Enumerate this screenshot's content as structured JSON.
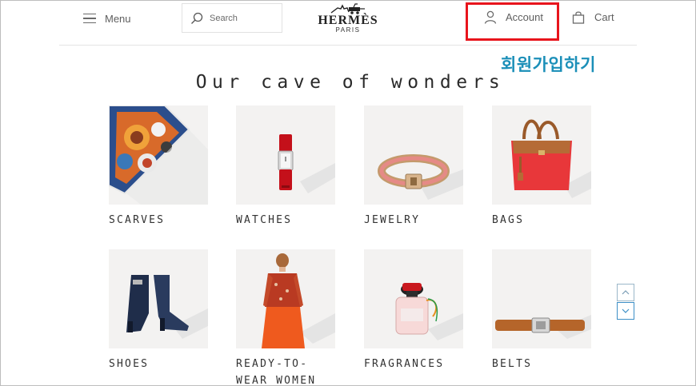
{
  "header": {
    "menu_label": "Menu",
    "search_placeholder": "Search",
    "logo_brand": "HERMÈS",
    "logo_city": "PARIS",
    "account_label": "Account",
    "cart_label": "Cart"
  },
  "annotation": {
    "signup_text": "회원가입하기",
    "highlight_color": "#e8141c",
    "text_color": "#1b8fb8"
  },
  "main": {
    "heading": "Our cave of wonders",
    "categories": [
      {
        "label": "SCARVES",
        "icon": "scarf-image"
      },
      {
        "label": "WATCHES",
        "icon": "watch-image"
      },
      {
        "label": "JEWELRY",
        "icon": "bracelet-image"
      },
      {
        "label": "BAGS",
        "icon": "handbag-image"
      },
      {
        "label": "SHOES",
        "icon": "boots-image"
      },
      {
        "label": "READY-TO-WEAR WOMEN",
        "icon": "woman-outfit-image"
      },
      {
        "label": "FRAGRANCES",
        "icon": "perfume-image"
      },
      {
        "label": "BELTS",
        "icon": "belt-image"
      }
    ]
  },
  "scroll": {
    "up_icon": "chevron-up-icon",
    "down_icon": "chevron-down-icon"
  }
}
